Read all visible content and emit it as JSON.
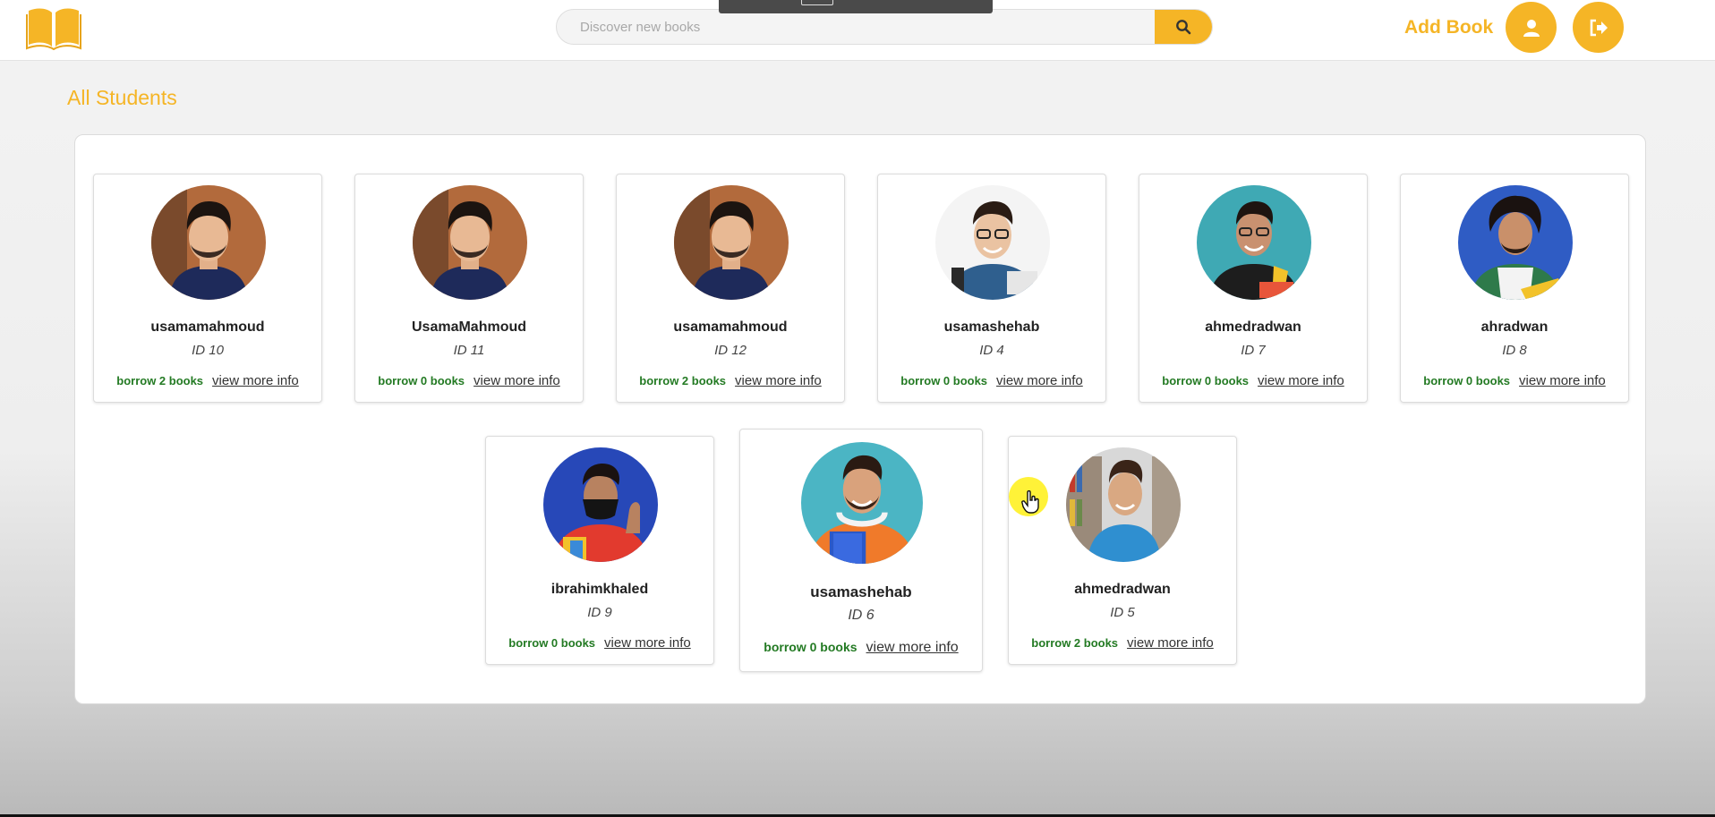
{
  "header": {
    "logo_icon": "open-book-icon",
    "search": {
      "placeholder": "Discover new books",
      "icon": "search-icon"
    },
    "add_book_label": "Add Book",
    "profile_icon": "user-icon",
    "logout_icon": "sign-out-icon"
  },
  "page": {
    "title": "All Students"
  },
  "colors": {
    "accent": "#f5b526",
    "borrow_text": "#237a23"
  },
  "students": [
    {
      "name": "usamamahmoud",
      "id": "ID 10",
      "borrow": "borrow 2 books",
      "more": "view more info",
      "avatar": "photo-bearded-man-brown-bg"
    },
    {
      "name": "UsamaMahmoud",
      "id": "ID 11",
      "borrow": "borrow 0 books",
      "more": "view more info",
      "avatar": "photo-bearded-man-brown-bg"
    },
    {
      "name": "usamamahmoud",
      "id": "ID 12",
      "borrow": "borrow 2 books",
      "more": "view more info",
      "avatar": "photo-bearded-man-brown-bg"
    },
    {
      "name": "usamashehab",
      "id": "ID 4",
      "borrow": "borrow 0 books",
      "more": "view more info",
      "avatar": "photo-student-glasses-white-bg"
    },
    {
      "name": "ahmedradwan",
      "id": "ID 7",
      "borrow": "borrow 0 books",
      "more": "view more info",
      "avatar": "photo-student-teal-bg"
    },
    {
      "name": "ahradwan",
      "id": "ID 8",
      "borrow": "borrow 0 books",
      "more": "view more info",
      "avatar": "photo-student-blue-bg"
    },
    {
      "name": "ibrahimkhaled",
      "id": "ID 9",
      "borrow": "borrow 0 books",
      "more": "view more info",
      "avatar": "photo-student-mask-blue-bg"
    },
    {
      "name": "usamashehab",
      "id": "ID 6",
      "borrow": "borrow 0 books",
      "more": "view more info",
      "avatar": "photo-student-headphones-teal-bg"
    },
    {
      "name": "ahmedradwan",
      "id": "ID 5",
      "borrow": "borrow 2 books",
      "more": "view more info",
      "avatar": "photo-student-library-bg"
    }
  ]
}
